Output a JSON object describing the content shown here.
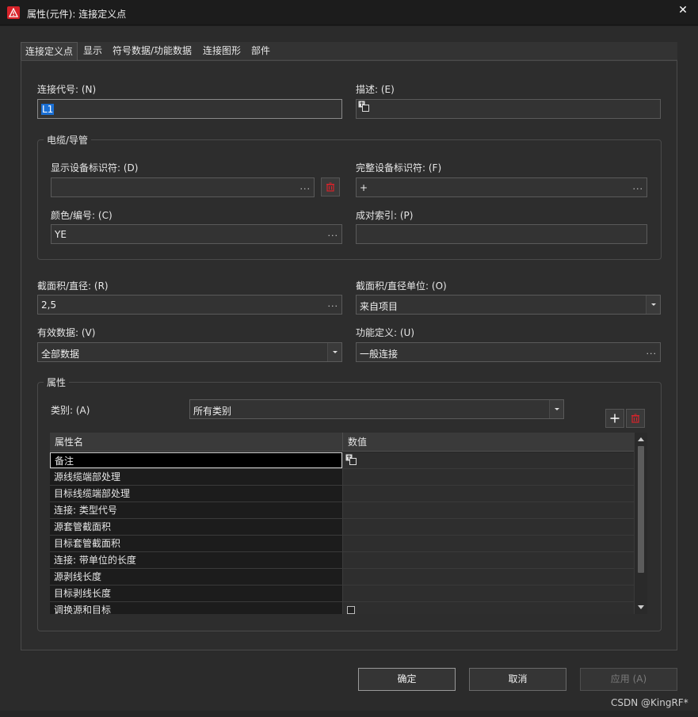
{
  "window": {
    "title": "属性(元件): 连接定义点",
    "close_glyph": "✕"
  },
  "tabs": [
    "连接定义点",
    "显示",
    "符号数据/功能数据",
    "连接图形",
    "部件"
  ],
  "fields": {
    "connection_code": {
      "label": "连接代号: (N)",
      "value": "L1"
    },
    "description": {
      "label": "描述: (E)",
      "value": ""
    },
    "display_device_id": {
      "label": "显示设备标识符: (D)",
      "value": ""
    },
    "full_device_id": {
      "label": "完整设备标识符: (F)",
      "value": "+"
    },
    "color_number": {
      "label": "颜色/编号: (C)",
      "value": "YE"
    },
    "pair_index": {
      "label": "成对索引: (P)",
      "value": ""
    },
    "cross_section": {
      "label": "截面积/直径: (R)",
      "value": "2,5"
    },
    "cross_section_unit": {
      "label": "截面积/直径单位: (O)",
      "value": "来自项目"
    },
    "valid_data": {
      "label": "有效数据: (V)",
      "value": "全部数据"
    },
    "function_definition": {
      "label": "功能定义: (U)",
      "value": "一般连接"
    }
  },
  "groups": {
    "cable": "电缆/导管",
    "properties": "属性"
  },
  "category": {
    "label": "类别: (A)",
    "value": "所有类别"
  },
  "table": {
    "headers": [
      "属性名",
      "数值"
    ],
    "rows": [
      "备注",
      "源线缆端部处理",
      "目标线缆端部处理",
      "连接: 类型代号",
      "源套管截面积",
      "目标套管截面积",
      "连接: 带单位的长度",
      "源剥线长度",
      "目标剥线长度",
      "调换源和目标"
    ]
  },
  "buttons": {
    "ok": "确定",
    "cancel": "取消",
    "apply": "应用 (A)"
  },
  "ellipsis": "...",
  "watermark": "CSDN @KingRF*",
  "colors": {
    "accent_red": "#d8232a",
    "selection_blue": "#1a6fd4"
  },
  "icons": [
    "app-logo-icon",
    "close-icon",
    "translate-icon",
    "trash-icon",
    "plus-icon",
    "dropdown-arrow-icon"
  ]
}
